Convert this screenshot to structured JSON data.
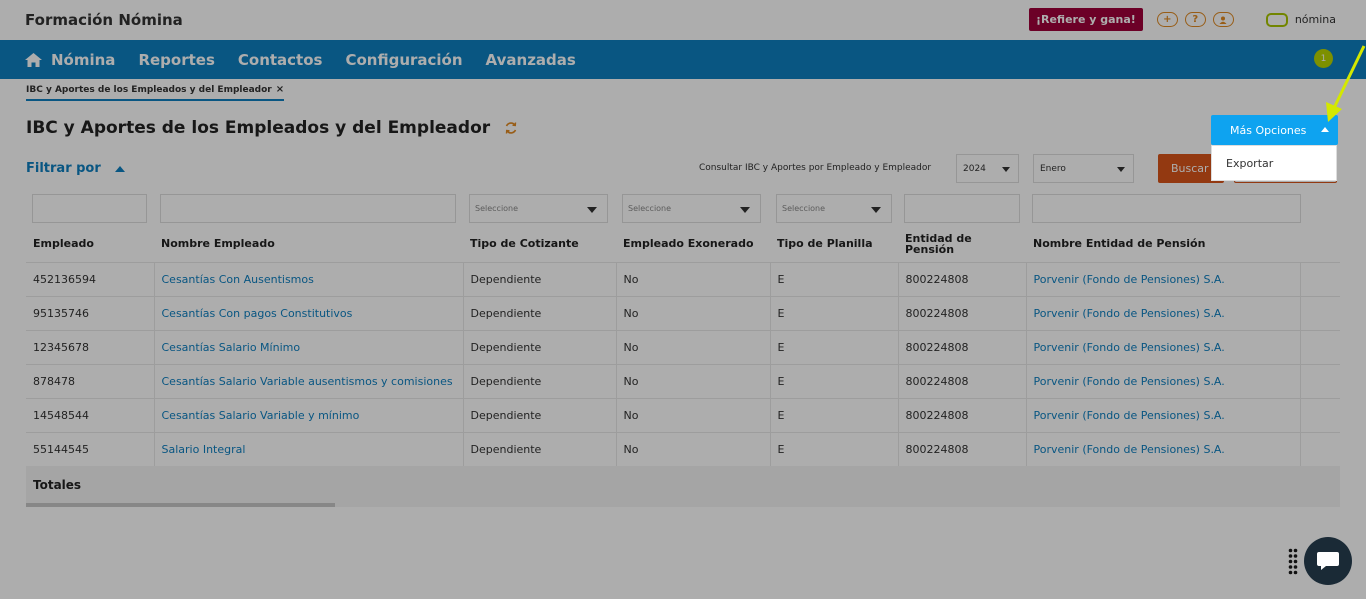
{
  "app": {
    "brand": "Formación Nómina",
    "refer_label": "¡Refiere y gana!",
    "header_icons": [
      "+",
      "?",
      "person-icon"
    ],
    "logo_text": "nómina"
  },
  "nav": {
    "items": [
      "Nómina",
      "Reportes",
      "Contactos",
      "Configuración",
      "Avanzadas"
    ],
    "notification_count": "1"
  },
  "tab": {
    "label": "IBC y Aportes de los Empleados y del Empleador",
    "close": "×"
  },
  "page": {
    "title": "IBC y Aportes de los Empleados y del Empleador",
    "filter_label": "Filtrar por",
    "consult_label": "Consultar IBC y Aportes por Empleado y Empleador",
    "year": "2024",
    "month": "Enero",
    "search_label": "Buscar",
    "more_options_label": "Más Opciones",
    "dropdown_item": "Exportar"
  },
  "filters": {
    "select_placeholder": "Seleccione"
  },
  "table": {
    "headers": [
      "Empleado",
      "Nombre Empleado",
      "Tipo de Cotizante",
      "Empleado Exonerado",
      "Tipo de Planilla",
      "Entidad de Pensión",
      "Nombre Entidad de Pensión"
    ],
    "rows": [
      [
        "452136594",
        "Cesantías Con Ausentismos",
        "Dependiente",
        "No",
        "E",
        "800224808",
        "Porvenir (Fondo de Pensiones) S.A."
      ],
      [
        "95135746",
        "Cesantías Con pagos Constitutivos",
        "Dependiente",
        "No",
        "E",
        "800224808",
        "Porvenir (Fondo de Pensiones) S.A."
      ],
      [
        "12345678",
        "Cesantías Salario Mínimo",
        "Dependiente",
        "No",
        "E",
        "800224808",
        "Porvenir (Fondo de Pensiones) S.A."
      ],
      [
        "878478",
        "Cesantías Salario Variable ausentismos y comisiones",
        "Dependiente",
        "No",
        "E",
        "800224808",
        "Porvenir (Fondo de Pensiones) S.A."
      ],
      [
        "14548544",
        "Cesantías Salario Variable y mínimo",
        "Dependiente",
        "No",
        "E",
        "800224808",
        "Porvenir (Fondo de Pensiones) S.A."
      ],
      [
        "55144545",
        "Salario Integral",
        "Dependiente",
        "No",
        "E",
        "800224808",
        "Porvenir (Fondo de Pensiones) S.A."
      ]
    ],
    "totals_label": "Totales"
  },
  "colors": {
    "nav": "#0e7fc0",
    "accent_button": "#0ea3f0",
    "search_button": "#d9551a",
    "refer_button": "#a0003a",
    "link": "#0e7fc0",
    "annotation_arrow": "#d4e800"
  }
}
